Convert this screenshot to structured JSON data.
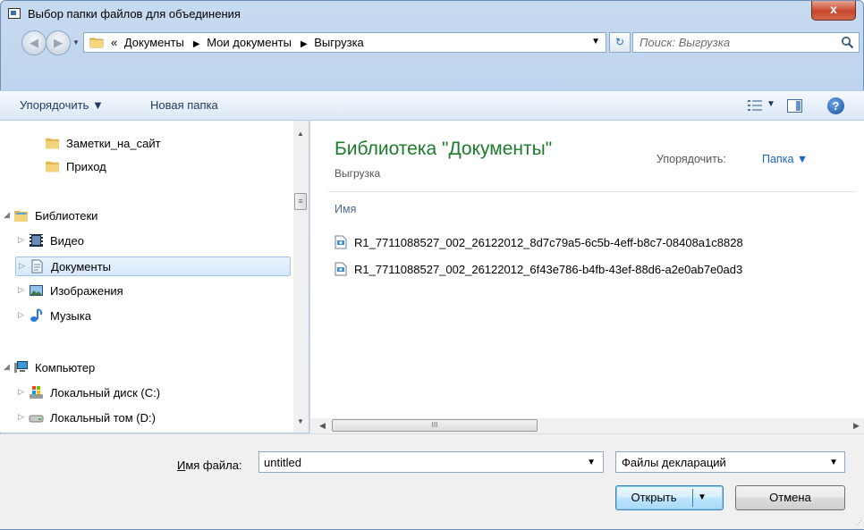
{
  "window": {
    "title": "Выбор папки файлов для объединения",
    "close": "x"
  },
  "nav": {
    "breadcrumbs": [
      "«",
      "Документы",
      "Мои документы",
      "Выгрузка"
    ],
    "separator": "▶",
    "search_placeholder": "Поиск: Выгрузка"
  },
  "toolbar": {
    "organize": "Упорядочить ▼",
    "new_folder": "Новая папка",
    "help": "?"
  },
  "tree": {
    "items": [
      {
        "label": "Заметки_на_сайт",
        "icon": "folder-icon"
      },
      {
        "label": "Приход",
        "icon": "folder-icon"
      },
      {
        "label": "Библиотеки",
        "icon": "libraries-icon",
        "expanded": true
      },
      {
        "label": "Видео",
        "icon": "video-library-icon"
      },
      {
        "label": "Документы",
        "icon": "documents-library-icon",
        "selected": true
      },
      {
        "label": "Изображения",
        "icon": "pictures-library-icon"
      },
      {
        "label": "Музыка",
        "icon": "music-library-icon"
      },
      {
        "label": "Компьютер",
        "icon": "computer-icon",
        "expanded": true
      },
      {
        "label": "Локальный диск (C:)",
        "icon": "system-drive-icon"
      },
      {
        "label": "Локальный том (D:)",
        "icon": "drive-icon"
      }
    ],
    "scrollbar_grip": "≡"
  },
  "content": {
    "library_title": "Библиотека \"Документы\"",
    "library_subtitle": "Выгрузка",
    "arrange_label": "Упорядочить:",
    "arrange_value": "Папка ▼",
    "column_name": "Имя",
    "files": [
      "R1_7711088527_002_26122012_8d7c79a5-6c5b-4eff-b8c7-08408a1c8828",
      "R1_7711088527_002_26122012_6f43e786-b4fb-43ef-88d6-a2e0ab7e0ad3"
    ],
    "hscroll_grip": "III"
  },
  "bottom": {
    "filename_label_underlined": "И",
    "filename_label_rest": "мя файла:",
    "filename_value": "untitled",
    "filetype_value": "Файлы деклараций",
    "open_button": "Открыть",
    "cancel_button": "Отмена"
  },
  "colors": {
    "library_title": "#1c7c2a",
    "link": "#1b64c7",
    "selection": "#d6e8fb"
  }
}
